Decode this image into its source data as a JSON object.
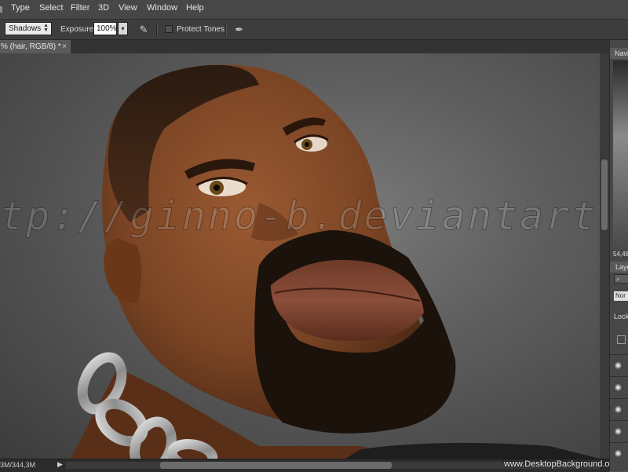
{
  "menu": [
    "Type",
    "Select",
    "Filter",
    "3D",
    "View",
    "Window",
    "Help"
  ],
  "options": {
    "range_value": "Shadows",
    "exposure_label": "Exposure:",
    "exposure_value": "100%",
    "exposure_dropdown_arrow": "▾",
    "protect_tones_label": "Protect Tones"
  },
  "document": {
    "tab_title": "% (hair, RGB/8) *",
    "tab_close": "×"
  },
  "canvas": {
    "watermark": "tp://ginno-b.deviantart.com"
  },
  "status": {
    "doc_size": "3M/344,3M",
    "play": "▶"
  },
  "credit": "www.DesktopBackground.org",
  "panels": {
    "navigator_tab": "Navi",
    "zoom": "54,48",
    "layers_tab": "Laye",
    "search_symbol": "⌕",
    "blend_mode": "Nor",
    "lock_label": "Lock"
  },
  "icons": {
    "eye": "◉",
    "brush_exposure": "✎",
    "brush_tablet": "✒"
  },
  "colors": {
    "menubar": "#474747",
    "options": "#3d3d3d",
    "canvas_bg": "#5e5e5e",
    "skin": "#7a4424",
    "beard": "#1c120c",
    "chain": "#a9a9a9"
  }
}
